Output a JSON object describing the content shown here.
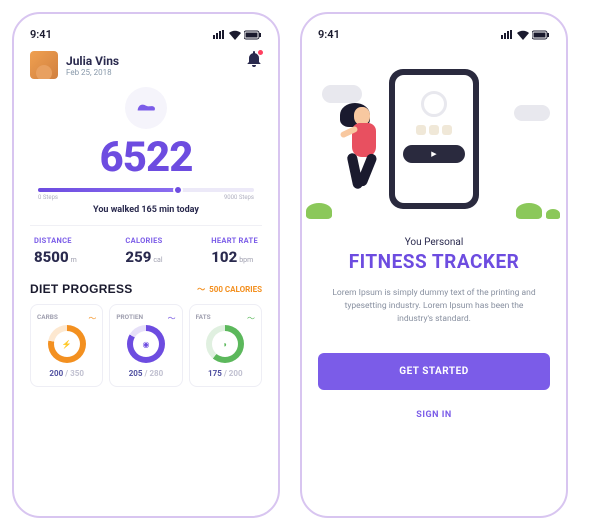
{
  "status": {
    "time": "9:41"
  },
  "user": {
    "name": "Julia Vins",
    "date": "Feb 25, 2018"
  },
  "steps": {
    "count": "6522",
    "min_label": "0 Steps",
    "max_label": "9000 Steps",
    "message": "You walked 165 min today"
  },
  "stats": {
    "distance": {
      "label": "DISTANCE",
      "value": "8500",
      "unit": "m"
    },
    "calories": {
      "label": "CALORIES",
      "value": "259",
      "unit": "cal"
    },
    "heart": {
      "label": "HEART RATE",
      "value": "102",
      "unit": "bpm"
    }
  },
  "diet": {
    "title": "DIET PROGRESS",
    "cal": "500 CALORIES",
    "cards": {
      "carbs": {
        "label": "CARBS",
        "v1": "200",
        "v2": "350"
      },
      "protein": {
        "label": "PROTIEN",
        "v1": "205",
        "v2": "280"
      },
      "fats": {
        "label": "FATS",
        "v1": "175",
        "v2": "200"
      }
    }
  },
  "onboard": {
    "subtitle": "You Personal",
    "title": "FITNESS TRACKER",
    "desc": "Lorem Ipsum is simply dummy text of the printing and typesetting industry. Lorem Ipsum has been the industry's standard.",
    "cta": "GET STARTED",
    "signin": "SIGN IN"
  }
}
